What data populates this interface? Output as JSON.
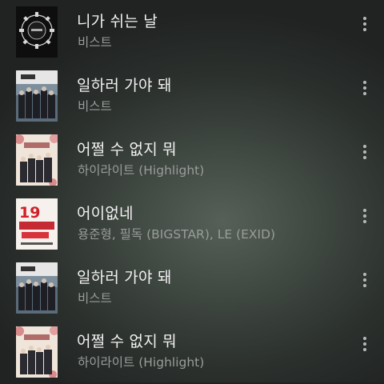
{
  "songs": [
    {
      "title": "니가 쉬는 날",
      "artist": "비스트",
      "art": "a"
    },
    {
      "title": "일하러 가야 돼",
      "artist": "비스트",
      "art": "b"
    },
    {
      "title": "어쩔 수 없지 뭐",
      "artist": "하이라이트 (Highlight)",
      "art": "c"
    },
    {
      "title": "어이없네",
      "artist": "용준형, 필독 (BIGSTAR), LE (EXID)",
      "art": "d"
    },
    {
      "title": "일하러 가야 돼",
      "artist": "비스트",
      "art": "b"
    },
    {
      "title": "어쩔 수 없지 뭐",
      "artist": "하이라이트 (Highlight)",
      "art": "c"
    }
  ],
  "icons": {
    "more": "more-vertical-icon"
  },
  "colors": {
    "title_text": "#f2f2f2",
    "artist_text": "#9a9d9b",
    "background": "#3e4640"
  }
}
